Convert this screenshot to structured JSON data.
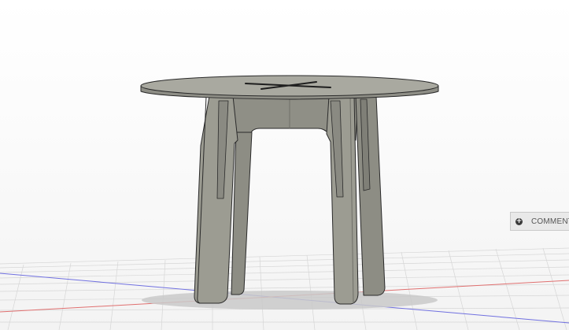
{
  "viewport": {
    "background": "#ffffff",
    "grid_color": "#d6d6d6",
    "x_axis_color": "#e06060",
    "z_axis_color": "#6a6ad8",
    "model_color": "#9c9c92",
    "model_edge_color": "#2a2a2a"
  },
  "comments_panel": {
    "icon": "plus-circle-icon",
    "label": "COMMENTS"
  }
}
